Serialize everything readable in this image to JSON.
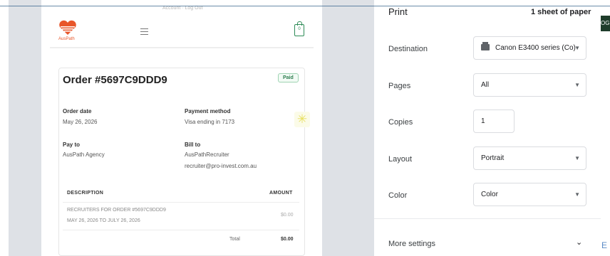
{
  "header": {
    "account_links": "Account · Log Out",
    "brand": "AusPath",
    "cart_count": "0"
  },
  "order": {
    "title": "Order #5697C9DDD9",
    "status": "Paid",
    "order_date_label": "Order date",
    "order_date": "May 26, 2026",
    "payment_method_label": "Payment method",
    "payment_method": "Visa ending in 7173",
    "pay_to_label": "Pay to",
    "pay_to": "AusPath Agency",
    "bill_to_label": "Bill to",
    "bill_to_name": "AusPathRecruiter",
    "bill_to_email": "recruiter@pro-invest.com.au",
    "table": {
      "headers": [
        "DESCRIPTION",
        "AMOUNT"
      ],
      "rows": [
        {
          "description": "RECRUITERS FOR ORDER #5697C9DDD9",
          "period": "MAY 26, 2026 TO JULY 26, 2026",
          "amount": "$0.00"
        }
      ],
      "total_label": "Total",
      "total_amount": "$0.00"
    }
  },
  "print": {
    "title": "Print",
    "sheet_count": "1 sheet of paper",
    "destination_label": "Destination",
    "destination_value": "Canon E3400 series (Co)",
    "pages_label": "Pages",
    "pages_value": "All",
    "copies_label": "Copies",
    "copies_value": "1",
    "layout_label": "Layout",
    "layout_value": "Portrait",
    "color_label": "Color",
    "color_value": "Color",
    "more_settings_label": "More settings"
  },
  "edge": {
    "top_right_text": "OG",
    "bottom_right_text": "E"
  },
  "colors": {
    "brand_orange": "#e8562a",
    "paid_green": "#2e7d4f",
    "preview_bg": "#dee1e6"
  }
}
